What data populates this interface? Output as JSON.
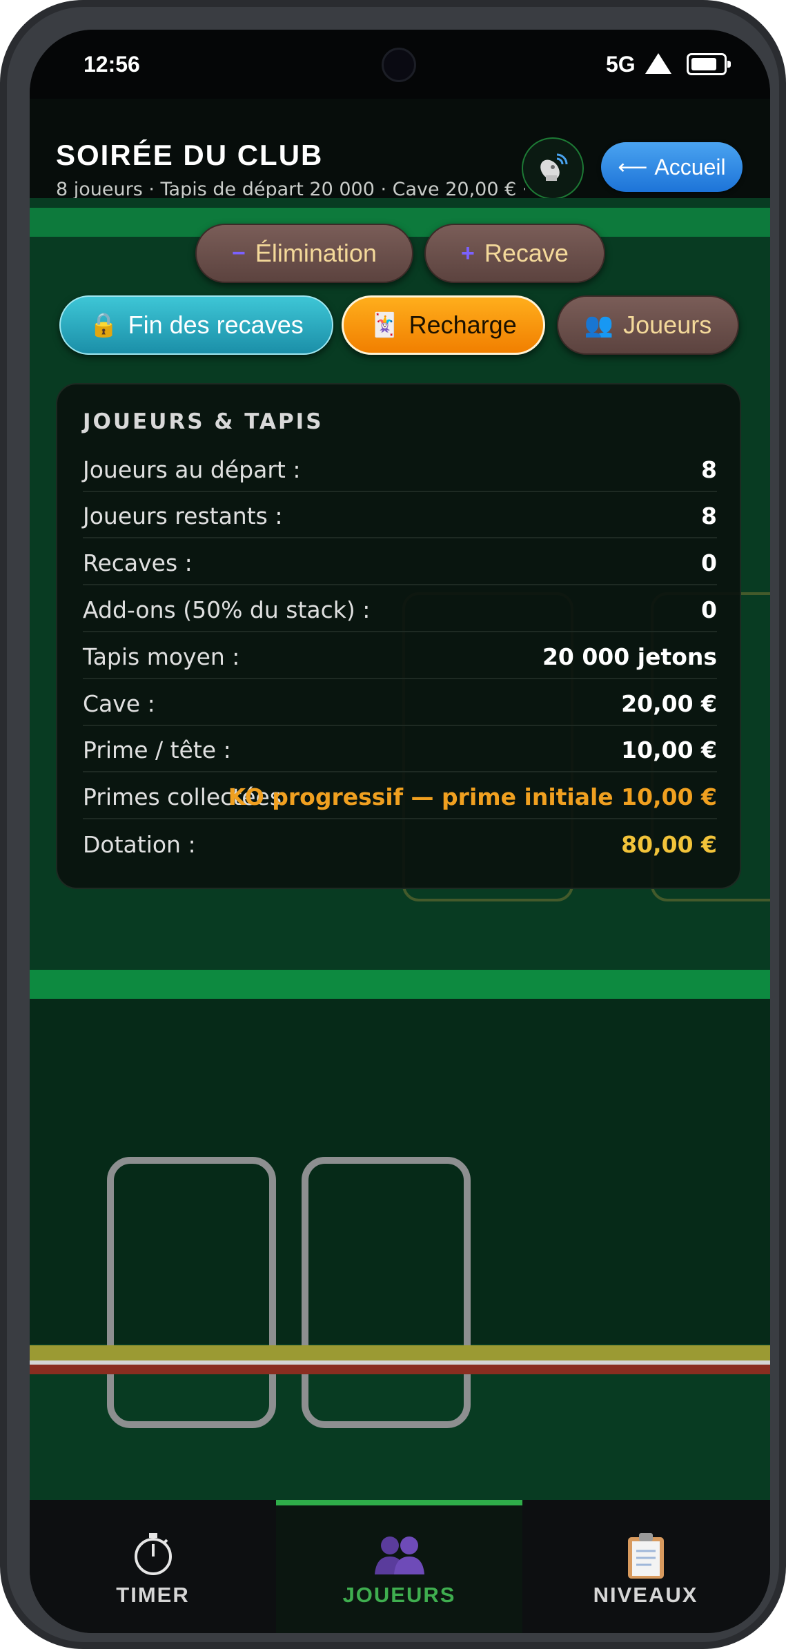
{
  "status_bar": {
    "time": "12:56",
    "network": "5G"
  },
  "header": {
    "title": "SOIRÉE DU CLUB",
    "subtitle": "8 joueurs · Tapis de départ 20 000 · Cave 20,00 € ·...",
    "home_label": "Accueil",
    "home_icon": "arrow-left-icon",
    "broadcast_icon": "satellite-dish-icon",
    "accent_color": "#1d74d8"
  },
  "actions": {
    "elimination_label": "Élimination",
    "recave_label": "Recave",
    "fin_recaves_label": "Fin des recaves",
    "recharge_label": "Recharge",
    "joueurs_label": "Joueurs"
  },
  "panel": {
    "title": "JOUEURS & TAPIS",
    "rows": [
      {
        "label": "Joueurs au départ :",
        "value": "8"
      },
      {
        "label": "Joueurs restants :",
        "value": "8"
      },
      {
        "label": "Recaves :",
        "value": "0"
      },
      {
        "label": "Add-ons (50% du stack) :",
        "value": "0"
      },
      {
        "label": "Tapis moyen :",
        "value": "20 000 jetons"
      },
      {
        "label": "Cave :",
        "value": "20,00 €"
      },
      {
        "label": "Prime / tête :",
        "value": "10,00 €"
      },
      {
        "label": "Primes collectées :",
        "value": "KO progressif — prime initiale 10,00 €"
      },
      {
        "label": "Dotation :",
        "value": "80,00 €"
      }
    ],
    "highlight_color": "#f0a020",
    "gold_color": "#f2c33a"
  },
  "nav": {
    "tabs": [
      {
        "label": "TIMER",
        "icon": "stopwatch-icon"
      },
      {
        "label": "JOUEURS",
        "icon": "players-icon",
        "active": true
      },
      {
        "label": "NIVEAUX",
        "icon": "clipboard-icon"
      }
    ],
    "active_color": "#3fae4f"
  }
}
